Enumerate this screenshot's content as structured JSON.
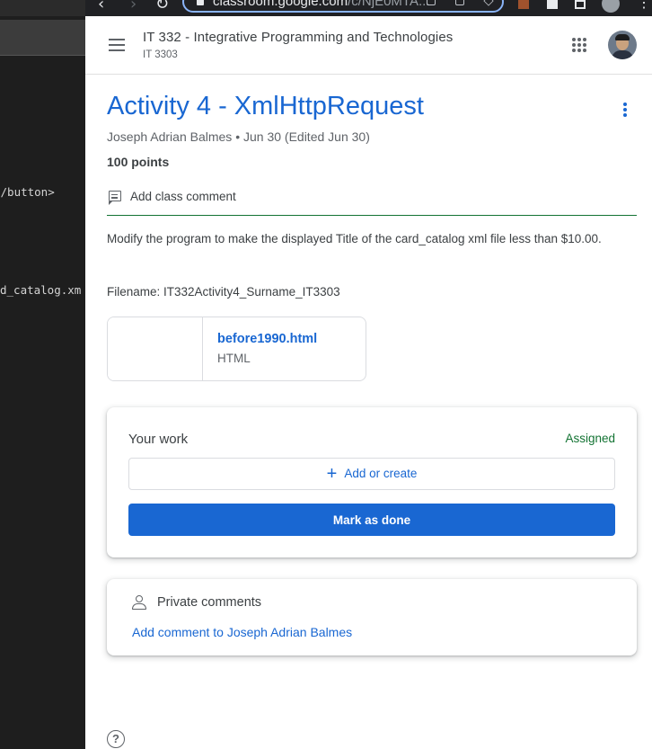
{
  "editor": {
    "code_lines": [
      "</button>",
      "d_catalog.xm"
    ]
  },
  "browser": {
    "url_host": "classroom.google.com",
    "url_path": "/c/NjE0MTA..."
  },
  "header": {
    "class_name": "IT 332 - Integrative Programming and Technologies",
    "class_section": "IT 3303"
  },
  "assignment": {
    "title": "Activity 4 - XmlHttpRequest",
    "meta": "Joseph Adrian Balmes • Jun 30 (Edited Jun 30)",
    "points": "100 points",
    "class_comment_label": "Add class comment",
    "description": "Modify the program to make the displayed Title of the card_catalog xml file less than $10.00.",
    "filename": "Filename: IT332Activity4_Surname_IT3303",
    "attachment": {
      "name": "before1990.html",
      "type": "HTML"
    }
  },
  "your_work": {
    "title": "Your work",
    "status": "Assigned",
    "status_color": "#137333",
    "add_label": "Add or create",
    "done_label": "Mark as done"
  },
  "private_comments": {
    "title": "Private comments",
    "link": "Add comment to Joseph Adrian Balmes"
  },
  "icons": {
    "help": "?"
  },
  "colors": {
    "accent": "#1967d2",
    "editor_bg": "#1e1e1e"
  }
}
